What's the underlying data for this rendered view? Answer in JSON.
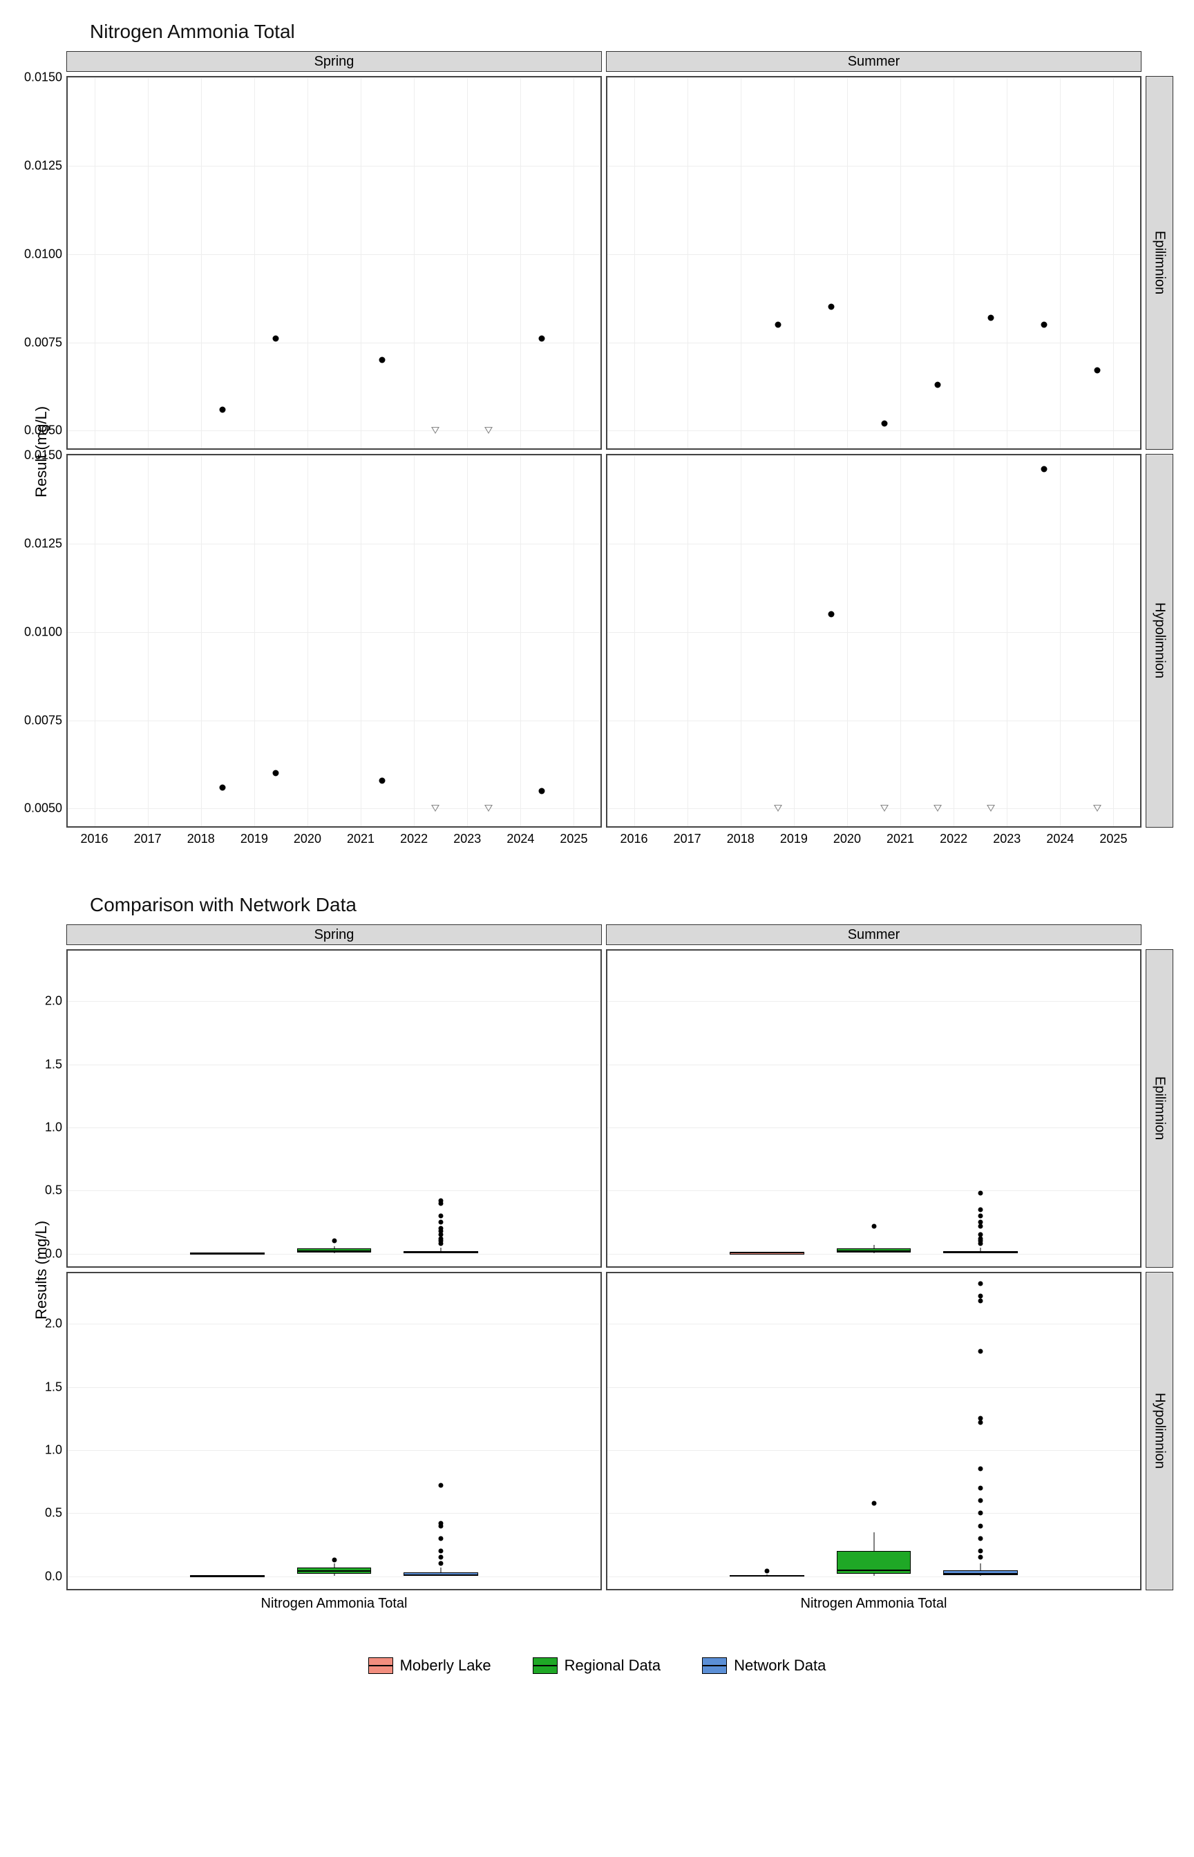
{
  "chart1": {
    "title": "Nitrogen Ammonia Total",
    "ylabel": "Result (mg/L)",
    "col_facets": [
      "Spring",
      "Summer"
    ],
    "row_facets": [
      "Epilimnion",
      "Hypolimnion"
    ],
    "x_ticks": [
      2016,
      2017,
      2018,
      2019,
      2020,
      2021,
      2022,
      2023,
      2024,
      2025
    ],
    "y_ticks": [
      "0.0050",
      "0.0075",
      "0.0100",
      "0.0125",
      "0.0150"
    ]
  },
  "chart2": {
    "title": "Comparison with Network Data",
    "ylabel": "Results (mg/L)",
    "col_facets": [
      "Spring",
      "Summer"
    ],
    "row_facets": [
      "Epilimnion",
      "Hypolimnion"
    ],
    "x_category": "Nitrogen Ammonia Total",
    "y_ticks": [
      "0.0",
      "0.5",
      "1.0",
      "1.5",
      "2.0"
    ]
  },
  "legend": {
    "items": [
      {
        "label": "Moberly Lake",
        "color": "#f28e7f"
      },
      {
        "label": "Regional Data",
        "color": "#1fa826"
      },
      {
        "label": "Network Data",
        "color": "#5b8fd6"
      }
    ]
  },
  "chart_data": [
    {
      "type": "scatter",
      "title": "Nitrogen Ammonia Total",
      "xlabel": "",
      "ylabel": "Result (mg/L)",
      "xlim": [
        2015.5,
        2025.5
      ],
      "ylim": [
        0.0045,
        0.015
      ],
      "facets": {
        "Spring|Epilimnion": {
          "points": [
            {
              "x": 2018.4,
              "y": 0.0056
            },
            {
              "x": 2019.4,
              "y": 0.0076
            },
            {
              "x": 2021.4,
              "y": 0.007
            },
            {
              "x": 2024.4,
              "y": 0.0076
            }
          ],
          "below_dl": [
            {
              "x": 2022.4,
              "y": 0.005
            },
            {
              "x": 2023.4,
              "y": 0.005
            }
          ]
        },
        "Summer|Epilimnion": {
          "points": [
            {
              "x": 2018.7,
              "y": 0.008
            },
            {
              "x": 2019.7,
              "y": 0.0085
            },
            {
              "x": 2020.7,
              "y": 0.0052
            },
            {
              "x": 2021.7,
              "y": 0.0063
            },
            {
              "x": 2022.7,
              "y": 0.0082
            },
            {
              "x": 2023.7,
              "y": 0.008
            },
            {
              "x": 2024.7,
              "y": 0.0067
            }
          ],
          "below_dl": []
        },
        "Spring|Hypolimnion": {
          "points": [
            {
              "x": 2018.4,
              "y": 0.0056
            },
            {
              "x": 2019.4,
              "y": 0.006
            },
            {
              "x": 2021.4,
              "y": 0.0058
            },
            {
              "x": 2024.4,
              "y": 0.0055
            }
          ],
          "below_dl": [
            {
              "x": 2022.4,
              "y": 0.005
            },
            {
              "x": 2023.4,
              "y": 0.005
            }
          ]
        },
        "Summer|Hypolimnion": {
          "points": [
            {
              "x": 2019.7,
              "y": 0.0105
            },
            {
              "x": 2023.7,
              "y": 0.0146
            }
          ],
          "below_dl": [
            {
              "x": 2018.7,
              "y": 0.005
            },
            {
              "x": 2020.7,
              "y": 0.005
            },
            {
              "x": 2021.7,
              "y": 0.005
            },
            {
              "x": 2022.7,
              "y": 0.005
            },
            {
              "x": 2024.7,
              "y": 0.005
            }
          ]
        }
      }
    },
    {
      "type": "boxplot",
      "title": "Comparison with Network Data",
      "ylabel": "Results (mg/L)",
      "ylim": [
        -0.1,
        2.4
      ],
      "categories": [
        "Nitrogen Ammonia Total"
      ],
      "series_names": [
        "Moberly Lake",
        "Regional Data",
        "Network Data"
      ],
      "facets": {
        "Spring|Epilimnion": {
          "boxes": [
            {
              "series": "Moberly Lake",
              "min": 0.005,
              "q1": 0.005,
              "median": 0.006,
              "q3": 0.008,
              "max": 0.008,
              "outliers": []
            },
            {
              "series": "Regional Data",
              "min": 0.003,
              "q1": 0.01,
              "median": 0.02,
              "q3": 0.04,
              "max": 0.06,
              "outliers": [
                0.1
              ]
            },
            {
              "series": "Network Data",
              "min": 0.003,
              "q1": 0.005,
              "median": 0.01,
              "q3": 0.02,
              "max": 0.05,
              "outliers": [
                0.08,
                0.1,
                0.12,
                0.15,
                0.18,
                0.2,
                0.25,
                0.3,
                0.4,
                0.42
              ]
            }
          ]
        },
        "Summer|Epilimnion": {
          "boxes": [
            {
              "series": "Moberly Lake",
              "min": 0.005,
              "q1": 0.006,
              "median": 0.008,
              "q3": 0.008,
              "max": 0.009,
              "outliers": []
            },
            {
              "series": "Regional Data",
              "min": 0.003,
              "q1": 0.01,
              "median": 0.02,
              "q3": 0.04,
              "max": 0.07,
              "outliers": [
                0.22
              ]
            },
            {
              "series": "Network Data",
              "min": 0.003,
              "q1": 0.005,
              "median": 0.01,
              "q3": 0.02,
              "max": 0.05,
              "outliers": [
                0.08,
                0.1,
                0.12,
                0.15,
                0.22,
                0.25,
                0.3,
                0.35,
                0.48
              ]
            }
          ]
        },
        "Spring|Hypolimnion": {
          "boxes": [
            {
              "series": "Moberly Lake",
              "min": 0.005,
              "q1": 0.005,
              "median": 0.006,
              "q3": 0.006,
              "max": 0.006,
              "outliers": []
            },
            {
              "series": "Regional Data",
              "min": 0.005,
              "q1": 0.02,
              "median": 0.04,
              "q3": 0.07,
              "max": 0.1,
              "outliers": [
                0.13
              ]
            },
            {
              "series": "Network Data",
              "min": 0.003,
              "q1": 0.005,
              "median": 0.01,
              "q3": 0.03,
              "max": 0.07,
              "outliers": [
                0.1,
                0.15,
                0.2,
                0.3,
                0.4,
                0.42,
                0.72
              ]
            }
          ]
        },
        "Summer|Hypolimnion": {
          "boxes": [
            {
              "series": "Moberly Lake",
              "min": 0.005,
              "q1": 0.005,
              "median": 0.005,
              "q3": 0.009,
              "max": 0.015,
              "outliers": [
                0.04
              ]
            },
            {
              "series": "Regional Data",
              "min": 0.005,
              "q1": 0.02,
              "median": 0.05,
              "q3": 0.2,
              "max": 0.35,
              "outliers": [
                0.58
              ]
            },
            {
              "series": "Network Data",
              "min": 0.003,
              "q1": 0.01,
              "median": 0.02,
              "q3": 0.05,
              "max": 0.1,
              "outliers": [
                0.15,
                0.2,
                0.3,
                0.4,
                0.5,
                0.6,
                0.7,
                0.85,
                1.22,
                1.25,
                1.78,
                2.18,
                2.22,
                2.32
              ]
            }
          ]
        }
      }
    }
  ]
}
